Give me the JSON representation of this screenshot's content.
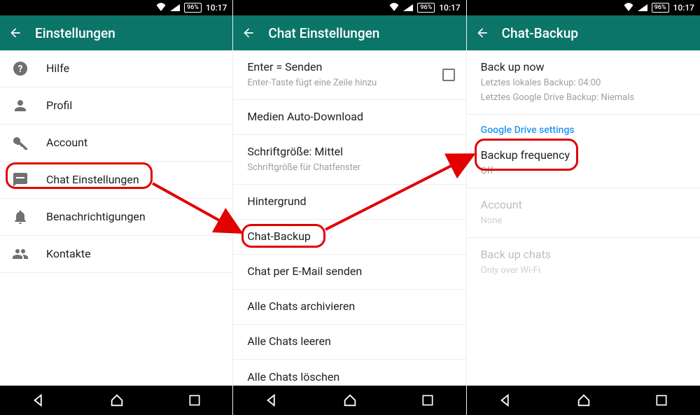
{
  "status": {
    "battery": "96%",
    "time": "10:17"
  },
  "screens": [
    {
      "title": "Einstellungen",
      "items": [
        {
          "icon": "help",
          "label": "Hilfe"
        },
        {
          "icon": "person",
          "label": "Profil"
        },
        {
          "icon": "key",
          "label": "Account"
        },
        {
          "icon": "chat",
          "label": "Chat Einstellungen"
        },
        {
          "icon": "bell",
          "label": "Benachrichtigungen"
        },
        {
          "icon": "people",
          "label": "Kontakte"
        }
      ]
    },
    {
      "title": "Chat Einstellungen",
      "items": [
        {
          "label": "Enter = Senden",
          "sub": "Enter-Taste fügt eine Zeile hinzu",
          "checkbox": true
        },
        {
          "label": "Medien Auto-Download"
        },
        {
          "label": "Schriftgröße: Mittel",
          "sub": "Schriftgröße für Chatfenster"
        },
        {
          "label": "Hintergrund"
        },
        {
          "label": "Chat-Backup"
        },
        {
          "label": "Chat per E-Mail senden"
        },
        {
          "label": "Alle Chats archivieren"
        },
        {
          "label": "Alle Chats leeren"
        },
        {
          "label": "Alle Chats löschen"
        }
      ]
    },
    {
      "title": "Chat-Backup",
      "items": [
        {
          "label": "Back up now",
          "sub": "Letztes lokales Backup: 04:00\nLetztes Google Drive Backup: Niemals"
        }
      ],
      "section": "Google Drive settings",
      "section_items": [
        {
          "label": "Backup frequency",
          "sub": "Off"
        },
        {
          "label": "Account",
          "sub": "None",
          "disabled": true
        },
        {
          "label": "Back up chats",
          "sub": "Only over Wi-Fi",
          "disabled": true
        }
      ]
    }
  ]
}
